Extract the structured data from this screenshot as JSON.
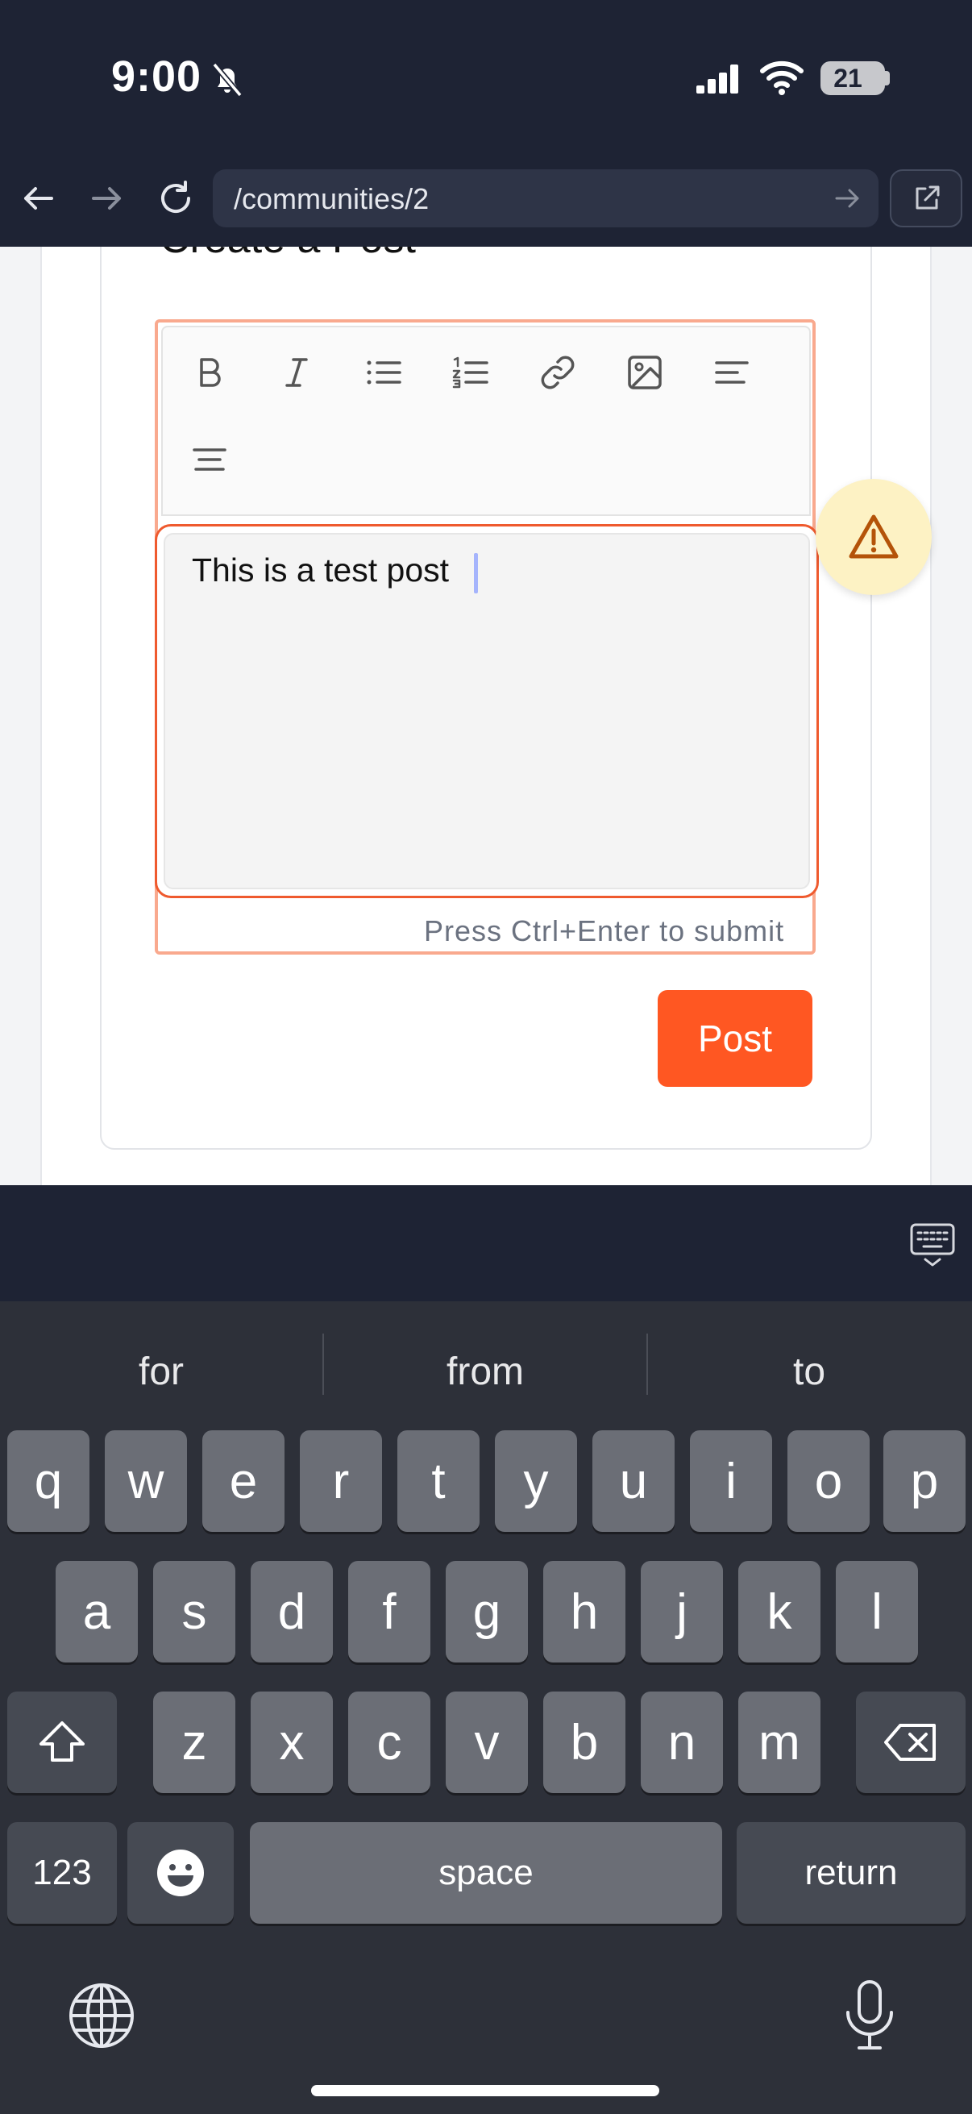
{
  "status_bar": {
    "time": "9:00",
    "battery": "21"
  },
  "browser": {
    "url": "/communities/2"
  },
  "page": {
    "card_title": "Create a Post",
    "editor_text": "This is a test post",
    "submit_hint": "Press Ctrl+Enter to submit",
    "post_button": "Post"
  },
  "keyboard": {
    "suggestions": [
      "for",
      "from",
      "to"
    ],
    "row1": [
      "q",
      "w",
      "e",
      "r",
      "t",
      "y",
      "u",
      "i",
      "o",
      "p"
    ],
    "row2": [
      "a",
      "s",
      "d",
      "f",
      "g",
      "h",
      "j",
      "k",
      "l"
    ],
    "row3": [
      "z",
      "x",
      "c",
      "v",
      "b",
      "n",
      "m"
    ],
    "numbers_key": "123",
    "space_key": "space",
    "return_key": "return"
  }
}
